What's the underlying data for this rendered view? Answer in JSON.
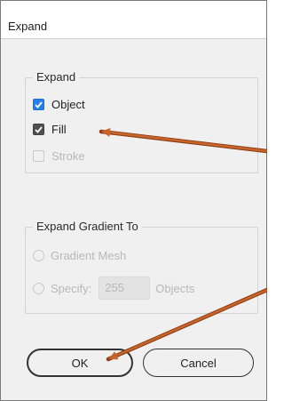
{
  "dialog": {
    "title": "Expand",
    "expand_group": {
      "legend": "Expand",
      "object": {
        "label": "Object",
        "checked": true
      },
      "fill": {
        "label": "Fill",
        "checked": true
      },
      "stroke": {
        "label": "Stroke",
        "checked": false,
        "disabled": true
      }
    },
    "gradient_group": {
      "legend": "Expand Gradient To",
      "gradient_mesh": {
        "label": "Gradient Mesh",
        "disabled": true
      },
      "specify": {
        "label": "Specify:",
        "value": "255",
        "unit": "Objects",
        "disabled": true
      }
    },
    "buttons": {
      "ok": "OK",
      "cancel": "Cancel"
    }
  },
  "colors": {
    "accent": "#2680eb",
    "annotation_arrow": "#c8642a"
  }
}
